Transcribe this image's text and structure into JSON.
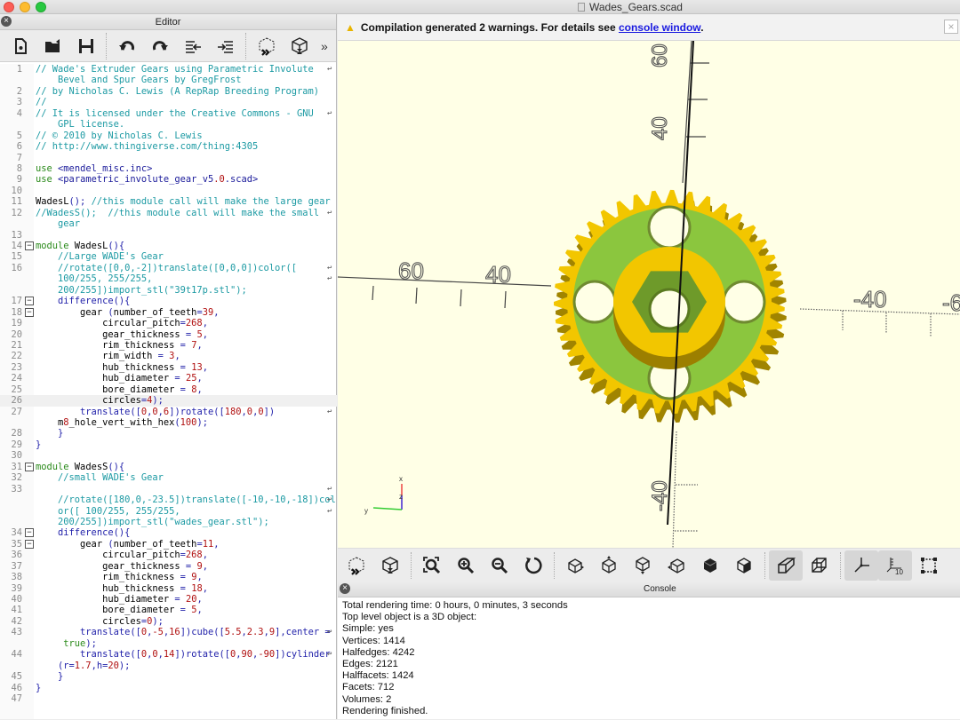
{
  "window": {
    "title": "Wades_Gears.scad"
  },
  "editor": {
    "title": "Editor",
    "toolbar": [
      {
        "name": "new-file-icon"
      },
      {
        "name": "open-file-icon"
      },
      {
        "name": "save-icon"
      },
      {
        "name": "undo-icon"
      },
      {
        "name": "redo-icon"
      },
      {
        "name": "unindent-icon"
      },
      {
        "name": "indent-icon"
      },
      {
        "name": "preview-icon"
      },
      {
        "name": "render-icon"
      }
    ],
    "more_label": "»",
    "lines": [
      {
        "n": "1",
        "t": "// Wade's Extruder Gears using Parametric Involute",
        "wrap": true,
        "cls": "c-com"
      },
      {
        "n": "",
        "t": "    Bevel and Spur Gears by GregFrost",
        "cls": "c-com"
      },
      {
        "n": "2",
        "t": "// by Nicholas C. Lewis (A RepRap Breeding Program)",
        "cls": "c-com"
      },
      {
        "n": "3",
        "t": "//",
        "cls": "c-com"
      },
      {
        "n": "4",
        "t": "// It is licensed under the Creative Commons - GNU",
        "wrap": true,
        "cls": "c-com"
      },
      {
        "n": "",
        "t": "    GPL license.",
        "cls": "c-com"
      },
      {
        "n": "5",
        "t": "// © 2010 by Nicholas C. Lewis",
        "cls": "c-com"
      },
      {
        "n": "6",
        "t": "// http://www.thingiverse.com/thing:4305",
        "cls": "c-com"
      },
      {
        "n": "7",
        "t": ""
      },
      {
        "n": "8",
        "t": "use <mendel_misc.inc>",
        "kw": "use"
      },
      {
        "n": "9",
        "t": "use <parametric_involute_gear_v5.0.scad>",
        "kw": "use"
      },
      {
        "n": "10",
        "t": ""
      },
      {
        "n": "11",
        "t": "WadesL(); //this module call will make the large gear",
        "mix": "call"
      },
      {
        "n": "12",
        "t": "//WadesS();  //this module call will make the small",
        "wrap": true,
        "cls": "c-com"
      },
      {
        "n": "",
        "t": "    gear",
        "cls": "c-com"
      },
      {
        "n": "13",
        "t": ""
      },
      {
        "n": "14",
        "t": "module WadesL(){",
        "fold": true,
        "kw": "module"
      },
      {
        "n": "15",
        "t": "    //Large WADE's Gear",
        "cls": "c-com"
      },
      {
        "n": "16",
        "t": "    //rotate([0,0,-2])translate([0,0,0])color([",
        "wrap": true,
        "cls": "c-com"
      },
      {
        "n": "",
        "t": "    100/255, 255/255,",
        "wrap": true,
        "cls": "c-com"
      },
      {
        "n": "",
        "t": "    200/255])import_stl(\"39t17p.stl\");",
        "cls": "c-com"
      },
      {
        "n": "17",
        "t": "    difference(){",
        "fold": true,
        "cls": "c-fn"
      },
      {
        "n": "18",
        "t": "        gear (number_of_teeth=39,",
        "fold": true,
        "cls": "c-txt"
      },
      {
        "n": "19",
        "t": "            circular_pitch=268,",
        "cls": "c-txt"
      },
      {
        "n": "20",
        "t": "            gear_thickness = 5,",
        "cls": "c-txt"
      },
      {
        "n": "21",
        "t": "            rim_thickness = 7,",
        "cls": "c-txt"
      },
      {
        "n": "22",
        "t": "            rim_width = 3,",
        "cls": "c-txt"
      },
      {
        "n": "23",
        "t": "            hub_thickness = 13,",
        "cls": "c-txt"
      },
      {
        "n": "24",
        "t": "            hub_diameter = 25,",
        "cls": "c-txt"
      },
      {
        "n": "25",
        "t": "            bore_diameter = 8,",
        "cls": "c-txt"
      },
      {
        "n": "26",
        "t": "            circles=4);",
        "cls": "c-txt",
        "current": true
      },
      {
        "n": "27",
        "t": "        translate([0,0,6])rotate([180,0,0])",
        "wrap": true,
        "cls": "c-fn"
      },
      {
        "n": "",
        "t": "    m8_hole_vert_with_hex(100);",
        "cls": "c-txt"
      },
      {
        "n": "28",
        "t": "    }",
        "cls": "c-fn"
      },
      {
        "n": "29",
        "t": "}",
        "cls": "c-fn"
      },
      {
        "n": "30",
        "t": ""
      },
      {
        "n": "31",
        "t": "module WadesS(){",
        "fold": true,
        "kw": "module"
      },
      {
        "n": "32",
        "t": "    //small WADE's Gear",
        "cls": "c-com"
      },
      {
        "n": "33",
        "t": "",
        "wrap": true
      },
      {
        "n": "",
        "t": "    //rotate([180,0,-23.5])translate([-10,-10,-18])col",
        "wrap": true,
        "cls": "c-com"
      },
      {
        "n": "",
        "t": "    or([ 100/255, 255/255,",
        "wrap": true,
        "cls": "c-com"
      },
      {
        "n": "",
        "t": "    200/255])import_stl(\"wades_gear.stl\");",
        "cls": "c-com"
      },
      {
        "n": "34",
        "t": "    difference(){",
        "fold": true,
        "cls": "c-fn"
      },
      {
        "n": "35",
        "t": "        gear (number_of_teeth=11,",
        "fold": true,
        "cls": "c-txt"
      },
      {
        "n": "36",
        "t": "            circular_pitch=268,",
        "cls": "c-txt"
      },
      {
        "n": "37",
        "t": "            gear_thickness = 9,",
        "cls": "c-txt"
      },
      {
        "n": "38",
        "t": "            rim_thickness = 9,",
        "cls": "c-txt"
      },
      {
        "n": "39",
        "t": "            hub_thickness = 18,",
        "cls": "c-txt"
      },
      {
        "n": "40",
        "t": "            hub_diameter = 20,",
        "cls": "c-txt"
      },
      {
        "n": "41",
        "t": "            bore_diameter = 5,",
        "cls": "c-txt"
      },
      {
        "n": "42",
        "t": "            circles=0);",
        "cls": "c-txt"
      },
      {
        "n": "43",
        "t": "        translate([0,-5,16])cube([5.5,2.3,9],center =",
        "wrap": true,
        "cls": "c-fn"
      },
      {
        "n": "",
        "t": "     true);",
        "cls": "c-kw"
      },
      {
        "n": "44",
        "t": "        translate([0,0,14])rotate([0,90,-90])cylinder",
        "wrap": true,
        "cls": "c-fn"
      },
      {
        "n": "",
        "t": "    (r=1.7,h=20);",
        "cls": "c-fn"
      },
      {
        "n": "45",
        "t": "    }",
        "cls": "c-fn"
      },
      {
        "n": "46",
        "t": "}",
        "cls": "c-fn"
      },
      {
        "n": "47",
        "t": ""
      }
    ]
  },
  "warning": {
    "text": "Compilation generated 2 warnings. For details see ",
    "link": "console window",
    "suffix": ".",
    "close": "×"
  },
  "viewport": {
    "background": "#ffffe6",
    "gear_color": "#f2c600",
    "face_color": "#8bc63e",
    "axis_labels": {
      "x_pos_a": "60",
      "x_pos_b": "40",
      "x_neg_a": "-40",
      "x_neg_b": "-6",
      "y_a": "60",
      "y_b": "40",
      "y_c": "-40"
    },
    "gizmo": {
      "x": "x",
      "y": "y",
      "z": "z"
    }
  },
  "view_toolbar": [
    {
      "name": "preview-icon"
    },
    {
      "name": "render-icon"
    },
    {
      "name": "view-all-icon"
    },
    {
      "name": "zoom-in-icon"
    },
    {
      "name": "zoom-out-icon"
    },
    {
      "name": "reset-view-icon"
    },
    {
      "name": "view-right-icon"
    },
    {
      "name": "view-top-icon"
    },
    {
      "name": "view-bottom-icon"
    },
    {
      "name": "view-left-icon"
    },
    {
      "name": "view-front-icon"
    },
    {
      "name": "view-back-icon"
    },
    {
      "name": "perspective-icon",
      "active": true
    },
    {
      "name": "orthogonal-icon"
    },
    {
      "name": "show-axes-icon",
      "active": true
    },
    {
      "name": "show-scale-icon",
      "active": true,
      "label": "10"
    },
    {
      "name": "show-edges-icon"
    }
  ],
  "console": {
    "title": "Console",
    "lines": [
      "Total rendering time: 0 hours, 0 minutes, 3 seconds",
      "Top level object is a 3D object:",
      "Simple: yes",
      "Vertices: 1414",
      "Halfedges: 4242",
      "Edges: 2121",
      "Halffacets: 1424",
      "Facets: 712",
      "Volumes: 2",
      "Rendering finished."
    ]
  }
}
